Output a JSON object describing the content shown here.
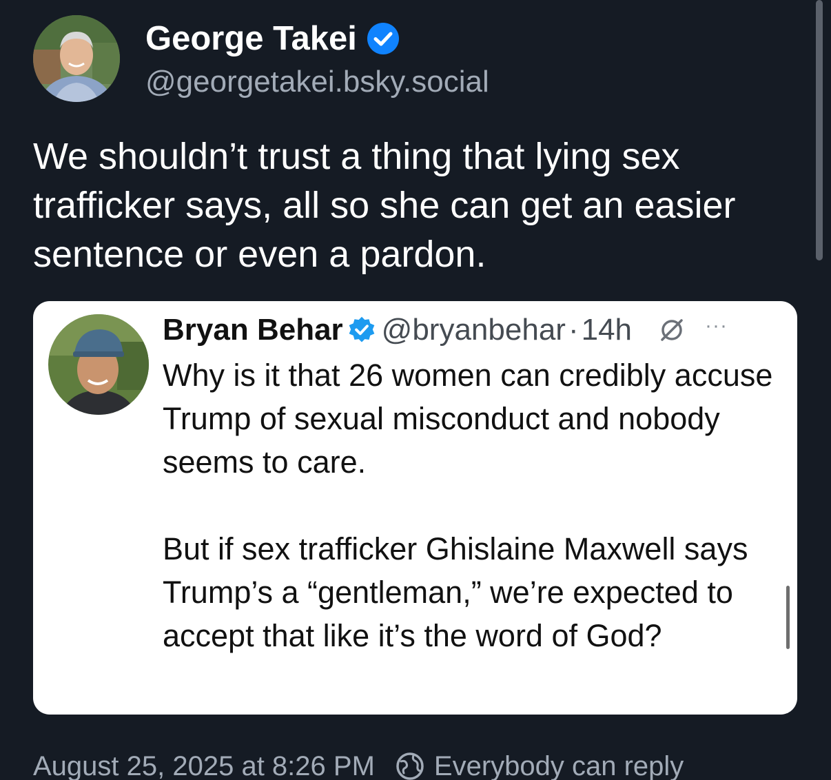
{
  "post": {
    "author": {
      "display_name": "George Takei",
      "handle": "@georgetakei.bsky.social",
      "verified_icon": "verified-check-icon"
    },
    "text": "We shouldn’t trust a thing that lying sex trafficker says, all so she can get an easier sentence or even a pardon.",
    "timestamp": "August 25, 2025 at 8:26 PM",
    "reply_setting": "Everybody can reply",
    "reply_setting_icon": "globe-icon"
  },
  "quoted_post": {
    "author": {
      "display_name": "Bryan Behar",
      "handle": "@bryanbehar",
      "separator": "·",
      "time_ago": "14h",
      "verified_icon": "verified-check-icon"
    },
    "more_label": "···",
    "paragraph_1": "Why is it that 26 women can credibly accuse Trump of sexual misconduct and nobody seems to care.",
    "paragraph_2": "But if sex trafficker Ghislaine Maxwell says Trump’s a “gentleman,” we’re expected to accept that like it’s the word of God?"
  },
  "colors": {
    "background": "#151b24",
    "primary_text": "#ffffff",
    "secondary_text": "#a2abb7",
    "verified_blue": "#1083fe",
    "card_background": "#ffffff"
  }
}
